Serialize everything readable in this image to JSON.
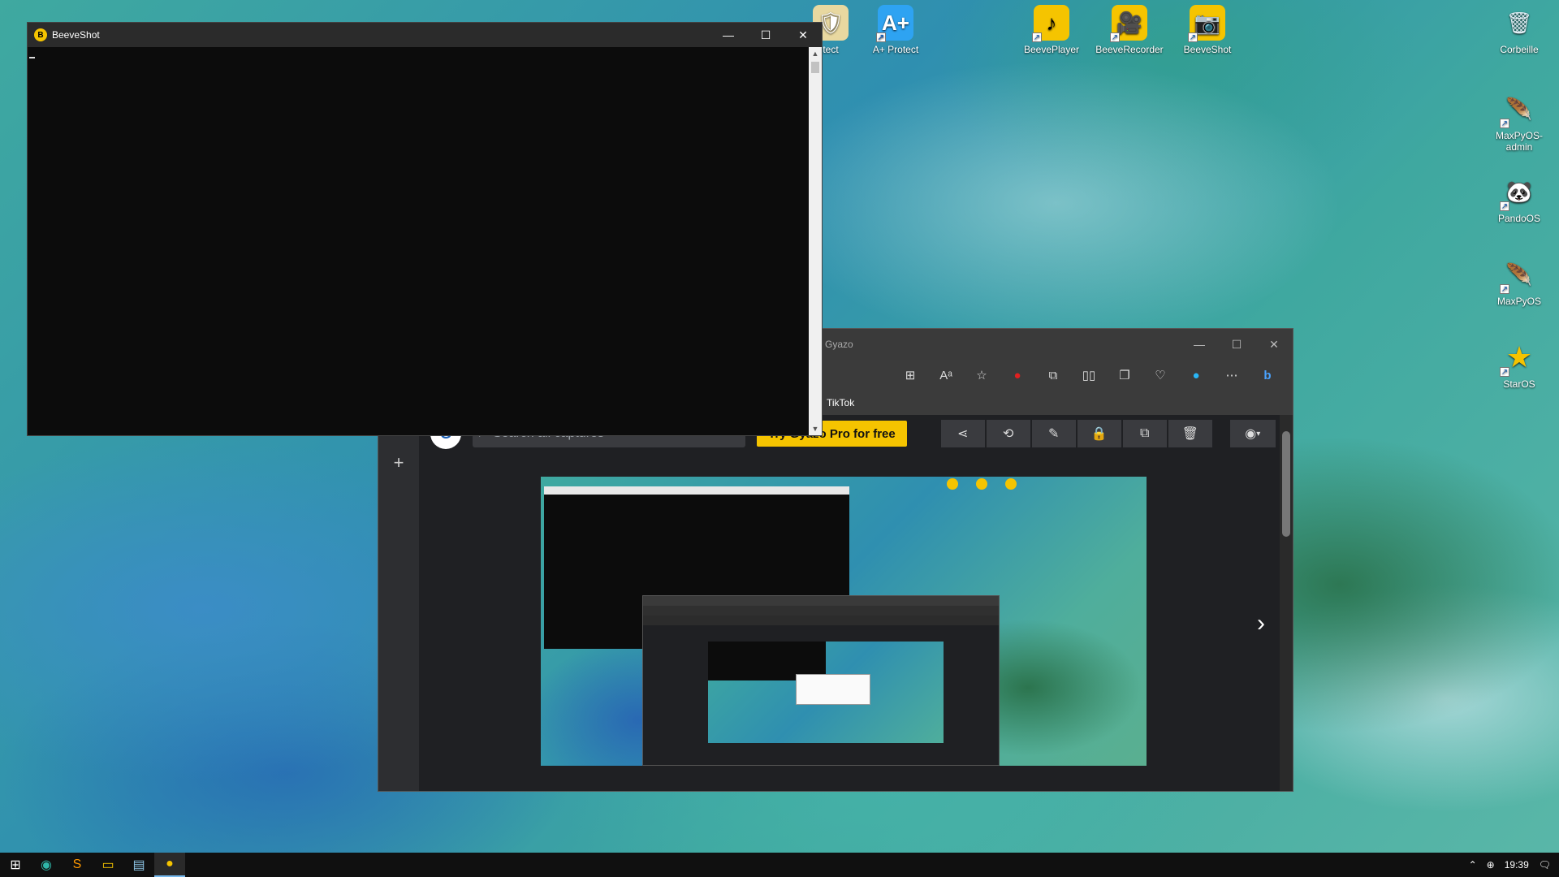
{
  "desktop": {
    "icons_top": [
      {
        "label": "tect",
        "glyph": "🛡"
      },
      {
        "label": "A+ Protect",
        "glyph": "A+"
      },
      {
        "label": "BeevePlayer",
        "glyph": "♪"
      },
      {
        "label": "BeeveRecorder",
        "glyph": "🎥"
      },
      {
        "label": "BeeveShot",
        "glyph": "📷"
      }
    ],
    "icons_right": [
      {
        "label": "Corbeille",
        "glyph": "🗑"
      },
      {
        "label": "MaxPyOS-admin",
        "glyph": "🪶"
      },
      {
        "label": "PandoOS",
        "glyph": "🐼"
      },
      {
        "label": "MaxPyOS",
        "glyph": "🪶"
      },
      {
        "label": "StarOS",
        "glyph": "★"
      }
    ]
  },
  "console_window": {
    "title": "BeeveShot",
    "app_icon": "B",
    "minimize": "—",
    "maximize": "☐",
    "close": "✕"
  },
  "gyazo_window": {
    "title": "Gyazo",
    "minimize": "—",
    "maximize": "☐",
    "close": "✕",
    "toolbar_icons": [
      "apps-icon",
      "read-aloud-icon",
      "favorite-star-icon",
      "extension-red-icon",
      "extensions-icon",
      "split-screen-icon",
      "collections-icon",
      "browser-essentials-icon",
      "profile-circle-icon",
      "more-icon",
      "bing-icon"
    ],
    "bookmark": "TikTok",
    "search_placeholder": "Search all captures",
    "pro_button": "Try Gyazo Pro for free",
    "action_icons": [
      "share-icon",
      "collection-icon",
      "edit-icon",
      "lock-icon",
      "copy-icon",
      "delete-icon"
    ],
    "add_label": "+",
    "next_label": "›"
  },
  "taskbar": {
    "time": "19:39",
    "items": [
      "start-button",
      "edge-icon",
      "sublime-icon",
      "file-explorer-icon",
      "notepad-icon",
      "beeveshot-taskbar-icon"
    ],
    "tray_arrow": "⌃",
    "notification": "🗨"
  },
  "colors": {
    "gyazo_yellow": "#f5c400",
    "console_bg": "#0c0c0c",
    "taskbar_bg": "#101010"
  }
}
